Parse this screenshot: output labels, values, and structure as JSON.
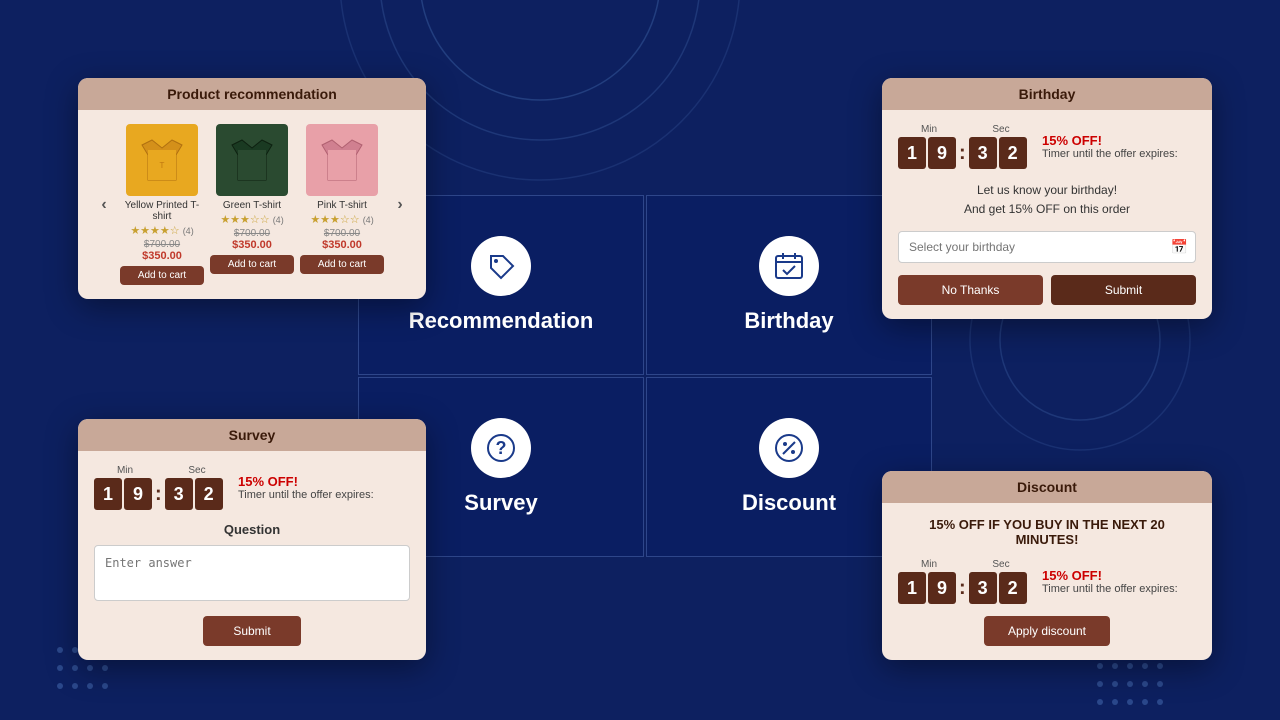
{
  "background": {
    "color": "#0d2060"
  },
  "recommendation_card": {
    "title": "Product recommendation",
    "products": [
      {
        "name": "Yellow\nPrinted T-shirt",
        "color": "yellow",
        "stars": "★★★★☆",
        "rating_count": "(4)",
        "price_old": "$700.00",
        "price_new": "$350.00",
        "add_to_cart": "Add to cart"
      },
      {
        "name": "Green T-shirt",
        "color": "green",
        "stars": "★★★☆☆",
        "rating_count": "(4)",
        "price_old": "$700.00",
        "price_new": "$350.00",
        "add_to_cart": "Add to cart"
      },
      {
        "name": "Pink T-shirt",
        "color": "pink",
        "stars": "★★★☆☆",
        "rating_count": "(4)",
        "price_old": "$700.00",
        "price_new": "$350.00",
        "add_to_cart": "Add to cart"
      }
    ]
  },
  "birthday_card": {
    "title": "Birthday",
    "timer": {
      "min_label": "Min",
      "sec_label": "Sec",
      "digits": [
        "1",
        "9",
        "3",
        "2"
      ],
      "off_text": "15% OFF!",
      "desc": "Timer until the offer expires:"
    },
    "info_line1": "Let us know your birthday!",
    "info_line2": "And get 15% OFF on this order",
    "input_placeholder": "Select your birthday",
    "btn_no_thanks": "No Thanks",
    "btn_submit": "Submit"
  },
  "survey_card": {
    "title": "Survey",
    "timer": {
      "min_label": "Min",
      "sec_label": "Sec",
      "digits": [
        "1",
        "9",
        "3",
        "2"
      ],
      "off_text": "15% OFF!",
      "desc": "Timer until the offer expires:"
    },
    "question_label": "Question",
    "input_placeholder": "Enter answer",
    "btn_submit": "Submit"
  },
  "discount_card": {
    "title": "Discount",
    "headline": "15% OFF IF YOU BUY IN THE NEXT 20 MINUTES!",
    "timer": {
      "min_label": "Min",
      "sec_label": "Sec",
      "digits": [
        "1",
        "9",
        "3",
        "2"
      ],
      "off_text": "15% OFF!",
      "desc": "Timer until the offer expires:"
    },
    "btn_apply": "Apply discount"
  },
  "grid_cells": [
    {
      "label": "Recommendation",
      "icon": "tag"
    },
    {
      "label": "Birthday",
      "icon": "calendar-check"
    },
    {
      "label": "Survey",
      "icon": "question"
    },
    {
      "label": "Discount",
      "icon": "percent"
    }
  ]
}
